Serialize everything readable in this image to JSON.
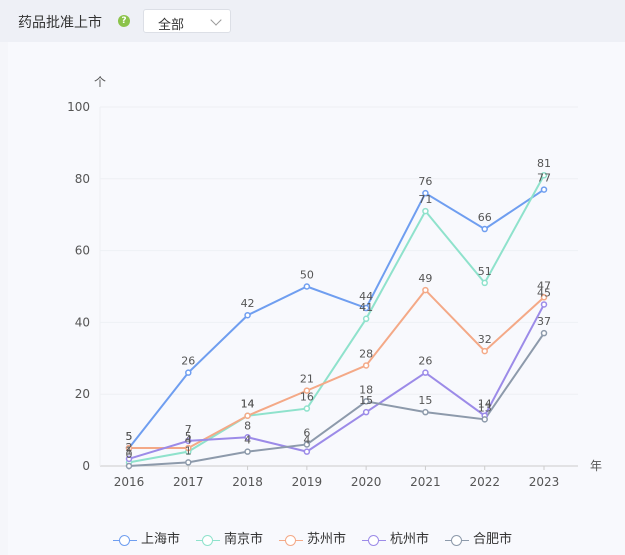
{
  "header": {
    "title": "药品批准上市",
    "filter_value": "全部"
  },
  "chart_data": {
    "type": "line",
    "x": [
      "2016",
      "2017",
      "2018",
      "2019",
      "2020",
      "2021",
      "2022",
      "2023"
    ],
    "y_unit": "个",
    "x_unit": "年",
    "ylim": [
      0,
      100
    ],
    "yticks": [
      0,
      20,
      40,
      60,
      80,
      100
    ],
    "grid": true,
    "legend_position": "bottom",
    "series": [
      {
        "name": "上海市",
        "color": "#6f9ef0",
        "values": [
          5,
          26,
          42,
          50,
          44,
          76,
          66,
          77
        ]
      },
      {
        "name": "南京市",
        "color": "#8fe2cc",
        "values": [
          1,
          4,
          14,
          16,
          41,
          71,
          51,
          81
        ]
      },
      {
        "name": "苏州市",
        "color": "#f4a987",
        "values": [
          5,
          5,
          14,
          21,
          28,
          49,
          32,
          47
        ]
      },
      {
        "name": "杭州市",
        "color": "#9c8be8",
        "values": [
          2,
          7,
          8,
          4,
          15,
          26,
          14,
          45
        ]
      },
      {
        "name": "合肥市",
        "color": "#8d9aab",
        "values": [
          0,
          1,
          4,
          6,
          18,
          15,
          13,
          37
        ]
      }
    ]
  }
}
